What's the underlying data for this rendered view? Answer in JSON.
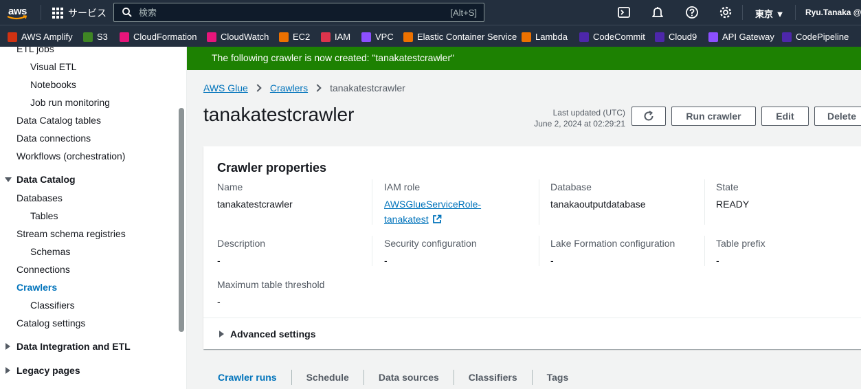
{
  "topnav": {
    "logo": "aws",
    "services_label": "サービス",
    "search_placeholder": "検索",
    "search_shortcut": "[Alt+S]",
    "region": "東京 ▼",
    "user": "Ryu.Tanaka @",
    "icons": [
      "cloudshell-icon",
      "bell-icon",
      "help-icon",
      "gear-icon"
    ]
  },
  "favorites": [
    {
      "label": "AWS Amplify",
      "color": "#d13212"
    },
    {
      "label": "S3",
      "color": "#3f8624"
    },
    {
      "label": "CloudFormation",
      "color": "#e7157b"
    },
    {
      "label": "CloudWatch",
      "color": "#e7157b"
    },
    {
      "label": "EC2",
      "color": "#ed7100"
    },
    {
      "label": "IAM",
      "color": "#dd344c"
    },
    {
      "label": "VPC",
      "color": "#8c4fff"
    },
    {
      "label": "Elastic Container Service",
      "color": "#ed7100"
    },
    {
      "label": "Lambda",
      "color": "#ed7100"
    },
    {
      "label": "CodeCommit",
      "color": "#4d27aa"
    },
    {
      "label": "Cloud9",
      "color": "#4d27aa"
    },
    {
      "label": "API Gateway",
      "color": "#8c4fff"
    },
    {
      "label": "CodePipeline",
      "color": "#4d27aa"
    }
  ],
  "sidebar": {
    "items": [
      "ETL jobs",
      "Visual ETL",
      "Notebooks",
      "Job run monitoring",
      "Data Catalog tables",
      "Data connections",
      "Workflows (orchestration)",
      "Data Catalog",
      "Databases",
      "Tables",
      "Stream schema registries",
      "Schemas",
      "Connections",
      "Crawlers",
      "Classifiers",
      "Catalog settings",
      "Data Integration and ETL",
      "Legacy pages"
    ]
  },
  "banner": {
    "message": "The following crawler is now created: \"tanakatestcrawler\""
  },
  "breadcrumb": [
    "AWS Glue",
    "Crawlers",
    "tanakatestcrawler"
  ],
  "header": {
    "title": "tanakatestcrawler",
    "last_updated_label": "Last updated (UTC)",
    "last_updated_value": "June 2, 2024 at 02:29:21",
    "run_label": "Run crawler",
    "edit_label": "Edit",
    "delete_label": "Delete"
  },
  "properties": {
    "title": "Crawler properties",
    "name_label": "Name",
    "name_value": "tanakatestcrawler",
    "iam_label": "IAM role",
    "iam_value_line1": "AWSGlueServiceRole-",
    "iam_value_line2": "tanakatest",
    "db_label": "Database",
    "db_value": "tanakaoutputdatabase",
    "state_label": "State",
    "state_value": "READY",
    "desc_label": "Description",
    "desc_value": "-",
    "sec_label": "Security configuration",
    "sec_value": "-",
    "lake_label": "Lake Formation configuration",
    "lake_value": "-",
    "prefix_label": "Table prefix",
    "prefix_value": "-",
    "max_label": "Maximum table threshold",
    "max_value": "-",
    "advanced_label": "Advanced settings"
  },
  "tabs": [
    "Crawler runs",
    "Schedule",
    "Data sources",
    "Classifiers",
    "Tags"
  ]
}
